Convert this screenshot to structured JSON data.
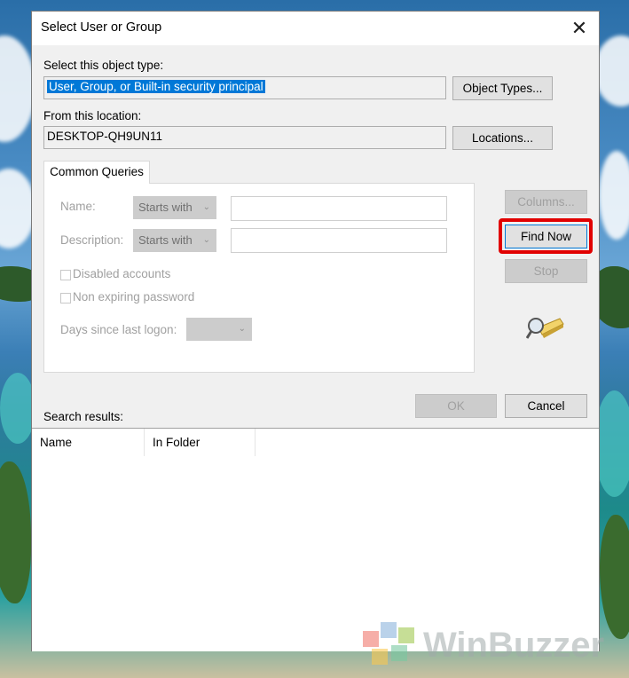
{
  "dialog": {
    "title": "Select User or Group",
    "object_type_label": "Select this object type:",
    "object_type_value": "User, Group, or Built-in security principal",
    "object_types_button": "Object Types...",
    "location_label": "From this location:",
    "location_value": "DESKTOP-QH9UN11",
    "locations_button": "Locations..."
  },
  "queries": {
    "tab_label": "Common Queries",
    "name_label": "Name:",
    "name_match": "Starts with",
    "description_label": "Description:",
    "description_match": "Starts with",
    "disabled_accounts_label": "Disabled accounts",
    "non_expiring_password_label": "Non expiring password",
    "days_since_logon_label": "Days since last logon:"
  },
  "actions": {
    "columns_button": "Columns...",
    "find_now_button": "Find Now",
    "stop_button": "Stop",
    "ok_button": "OK",
    "cancel_button": "Cancel"
  },
  "results": {
    "label": "Search results:",
    "columns": [
      "Name",
      "In Folder"
    ]
  },
  "watermark": "WinBuzzer",
  "colors": {
    "selection": "#0078d7",
    "highlight": "#e10000"
  }
}
